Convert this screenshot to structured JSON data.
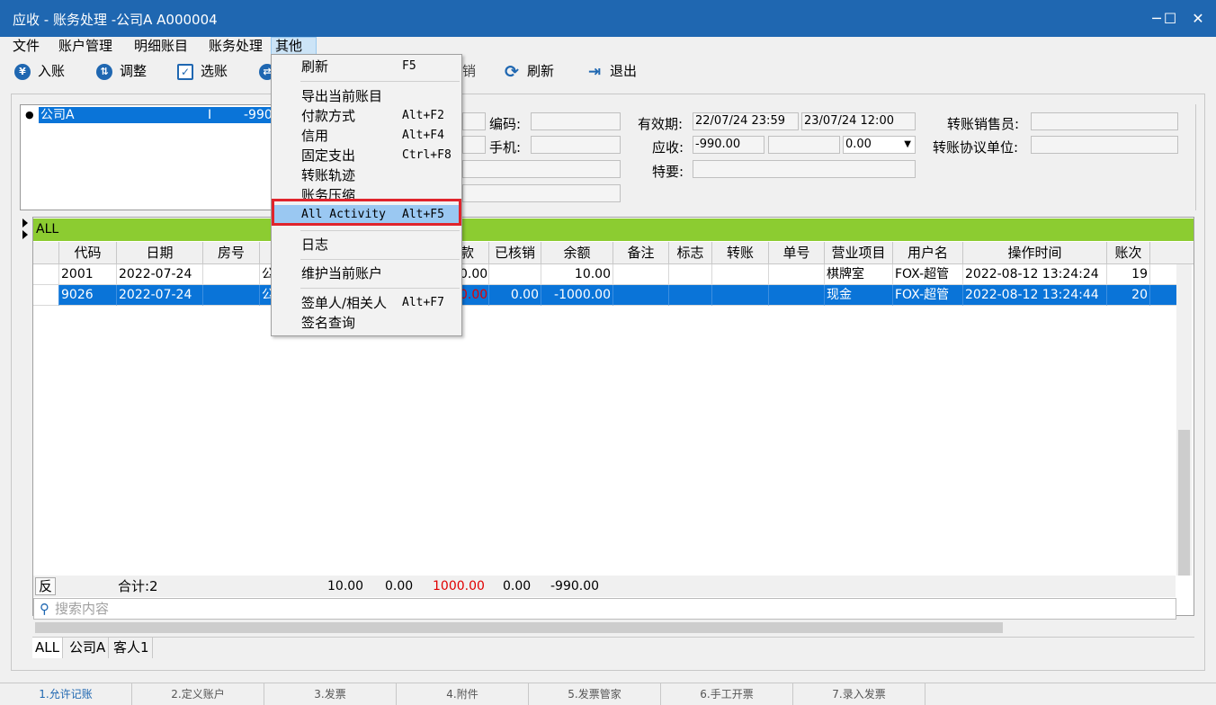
{
  "window": {
    "title": "应收 - 账务处理 -公司A  A000004",
    "minimize": "─",
    "maximize": "☐",
    "close": "✕"
  },
  "menu": [
    "文件",
    "账户管理",
    "明细账目",
    "账务处理",
    "其他"
  ],
  "toolbar": {
    "post": "入账",
    "adjust": "调整",
    "select": "选账",
    "writeoff_partial": "销",
    "refresh": "刷新",
    "exit": "退出"
  },
  "account_list": {
    "name": "公司A",
    "type": "I",
    "balance": "-990."
  },
  "info": {
    "code_label": "编码:",
    "mobile_label": "手机:",
    "valid_label": "有效期:",
    "valid_from": "22/07/24 23:59",
    "valid_to": "23/07/24 12:00",
    "receivable_label": "应收:",
    "receivable": "-990.00",
    "receivable_extra": "0.00",
    "special_label": "特要:",
    "sales_label": "转账销售员:",
    "unit_label": "转账协议单位:"
  },
  "grid": {
    "group": "ALL",
    "headers": [
      "代码",
      "日期",
      "房号",
      "",
      "款",
      "已核销",
      "余额",
      "备注",
      "标志",
      "转账",
      "单号",
      "营业项目",
      "用户名",
      "操作时间",
      "账次"
    ],
    "rows": [
      {
        "code": "2001",
        "date": "2022-07-24",
        "room": "",
        "name": "公",
        "amount": "0.00",
        "written_off": "",
        "balance": "10.00",
        "note": "",
        "flag": "",
        "transfer": "",
        "no": "",
        "item": "棋牌室",
        "user": "FOX-超管",
        "time": "2022-08-12 13:24:24",
        "seq": "19"
      },
      {
        "code": "9026",
        "date": "2022-07-24",
        "room": "",
        "name": "公",
        "amount": "0.00",
        "written_off": "0.00",
        "balance": "-1000.00",
        "note": "",
        "flag": "",
        "transfer": "",
        "no": "",
        "item": "现金",
        "user": "FOX-超管",
        "time": "2022-08-12 13:24:44",
        "seq": "20"
      }
    ],
    "footer": {
      "reverse": "反",
      "total": "合计:2",
      "v1": "10.00",
      "v2": "0.00",
      "v3": "1000.00",
      "v4": "0.00",
      "v5": "-990.00"
    },
    "search_placeholder": "搜索内容",
    "tabs": [
      "ALL",
      "公司A",
      "客人1"
    ]
  },
  "status_tabs": [
    "1.允许记账",
    "2.定义账户",
    "3.发票",
    "4.附件",
    "5.发票管家",
    "6.手工开票",
    "7.录入发票"
  ],
  "dropdown": [
    {
      "label": "刷新",
      "shortcut": "F5"
    },
    {
      "label": "导出当前账目",
      "shortcut": ""
    },
    {
      "label": "付款方式",
      "shortcut": "Alt+F2"
    },
    {
      "label": "信用",
      "shortcut": "Alt+F4"
    },
    {
      "label": "固定支出",
      "shortcut": "Ctrl+F8"
    },
    {
      "label": "转账轨迹",
      "shortcut": ""
    },
    {
      "label": "账务压缩",
      "shortcut": ""
    },
    {
      "label": "All Activity",
      "shortcut": "Alt+F5"
    },
    {
      "label": "日志",
      "shortcut": ""
    },
    {
      "label": "维护当前账户",
      "shortcut": ""
    },
    {
      "label": "签单人/相关人",
      "shortcut": "Alt+F7"
    },
    {
      "label": "签名查询",
      "shortcut": ""
    }
  ],
  "colors": {
    "titlebar": "#1f67b1",
    "selection": "#0a74d8",
    "group": "#8ccc31",
    "highlight_box": "#e0242c",
    "negative": "#e00000"
  },
  "icons": [
    "yen-icon",
    "adjust-icon",
    "select-icon",
    "refresh-icon",
    "exit-icon",
    "search-icon",
    "minimize-icon",
    "maximize-icon",
    "close-icon"
  ]
}
